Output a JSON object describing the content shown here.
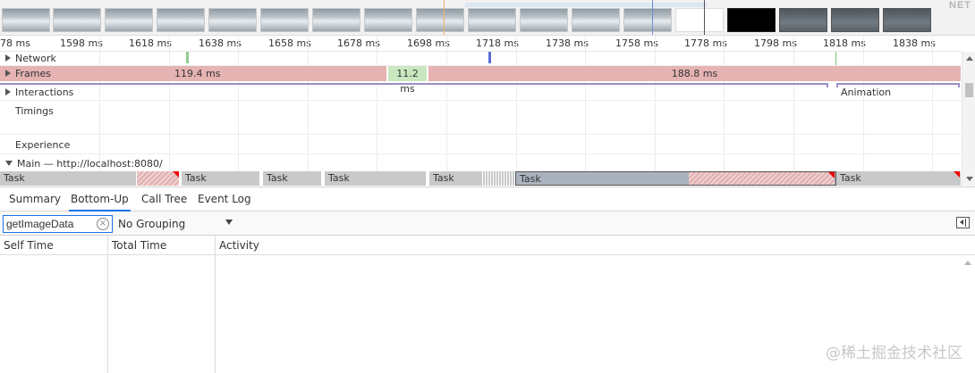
{
  "filmstrip": {
    "overflow_label": "NET"
  },
  "ruler": {
    "ticks": [
      "78 ms",
      "1598 ms",
      "1618 ms",
      "1638 ms",
      "1658 ms",
      "1678 ms",
      "1698 ms",
      "1718 ms",
      "1738 ms",
      "1758 ms",
      "1778 ms",
      "1798 ms",
      "1818 ms",
      "1838 ms"
    ]
  },
  "tracks": {
    "network": "Network",
    "frames": "Frames",
    "interactions": "Interactions",
    "animation": "Animation",
    "timings": "Timings",
    "experience": "Experience",
    "main": "Main — http://localhost:8080/"
  },
  "frames": [
    "119.4 ms",
    "11.2 ms",
    "188.8 ms"
  ],
  "tasks": [
    "Task",
    "Task",
    "Task",
    "Task",
    "Task",
    "Task",
    "Task"
  ],
  "tabs": {
    "summary": "Summary",
    "bottom_up": "Bottom-Up",
    "call_tree": "Call Tree",
    "event_log": "Event Log"
  },
  "toolbar": {
    "filter_value": "getImageData",
    "grouping_value": "No Grouping"
  },
  "table": {
    "self_time": "Self Time",
    "total_time": "Total Time",
    "activity": "Activity"
  },
  "watermark": "@稀土掘金技术社区",
  "colors": {
    "accent": "#1a73e8",
    "frame_long": "#e6b3b3",
    "frame_short": "#c9e8c0",
    "task": "#c9c9c9",
    "long_task_marker": "#ee0000"
  }
}
